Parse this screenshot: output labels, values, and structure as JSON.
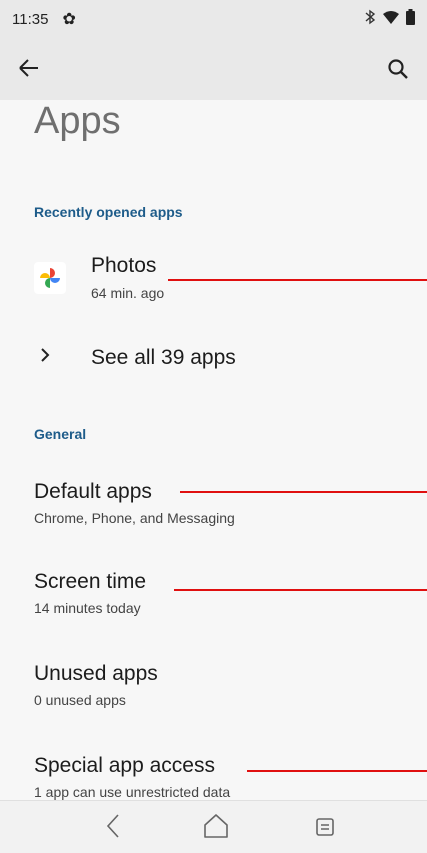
{
  "status_bar": {
    "time": "11:35",
    "icons": [
      "settings-gear-icon",
      "bluetooth-icon",
      "wifi-icon",
      "battery-icon"
    ]
  },
  "toolbar": {
    "back_icon": "back-arrow-icon",
    "search_icon": "search-icon"
  },
  "page": {
    "title": "Apps"
  },
  "recent_section": {
    "header": "Recently opened apps",
    "apps": [
      {
        "name": "Photos",
        "subtitle": "64 min. ago",
        "icon": "google-photos-icon"
      }
    ],
    "see_all_label": "See all 39 apps"
  },
  "general_section": {
    "header": "General",
    "items": [
      {
        "title": "Default apps",
        "subtitle": "Chrome, Phone, and Messaging"
      },
      {
        "title": "Screen time",
        "subtitle": "14 minutes today"
      },
      {
        "title": "Unused apps",
        "subtitle": "0 unused apps"
      },
      {
        "title": "Special app access",
        "subtitle": "1 app can use unrestricted data"
      }
    ]
  },
  "colors": {
    "accent": "#1e5c8a",
    "annotation_line": "#e01010"
  },
  "nav_bar": {
    "buttons": [
      "back-nav-icon",
      "home-nav-icon",
      "recents-nav-icon"
    ]
  }
}
